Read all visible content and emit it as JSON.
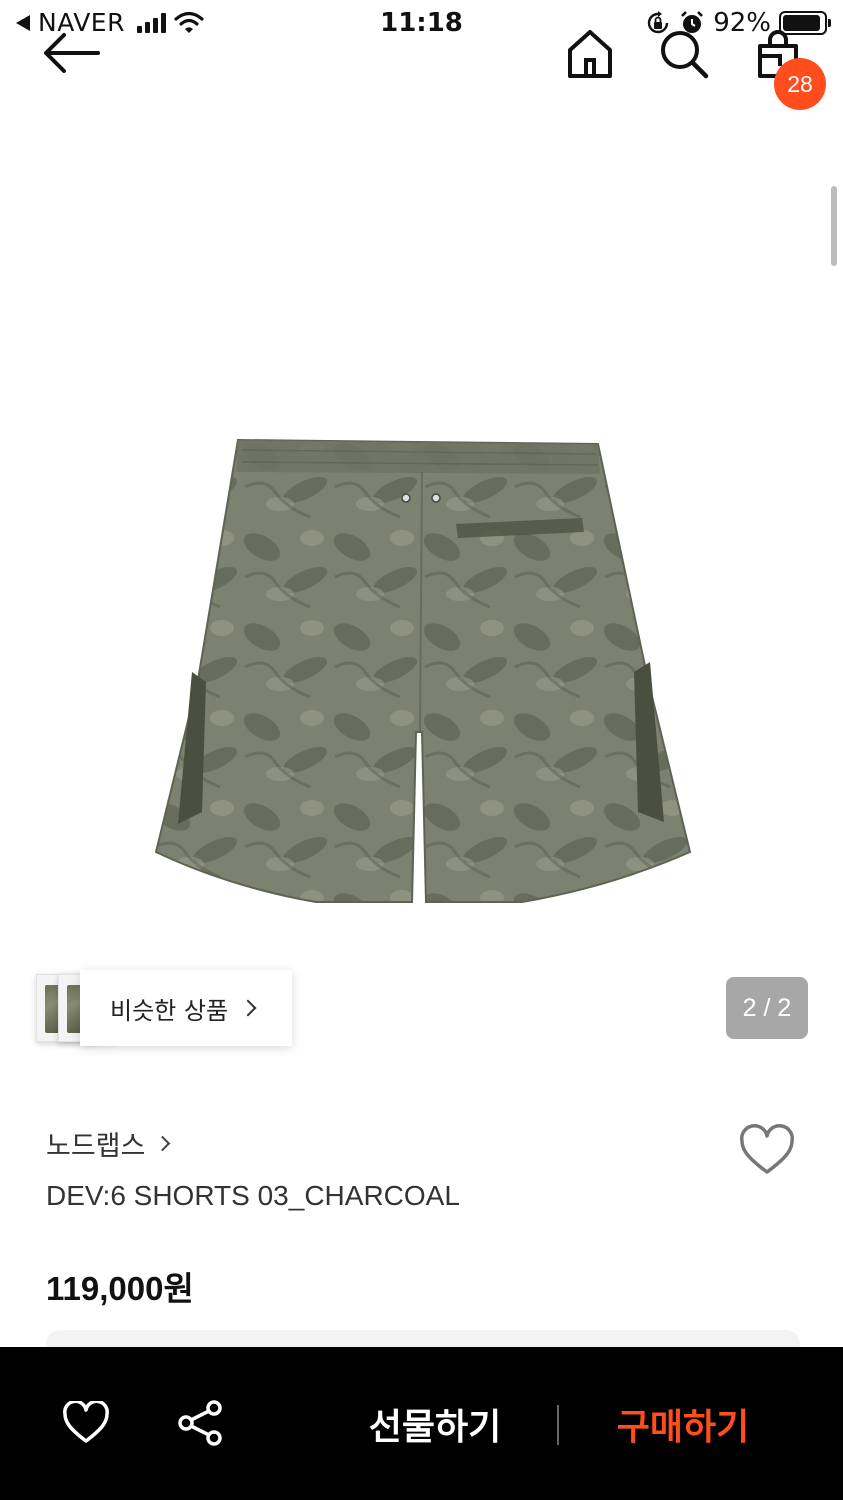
{
  "status_bar": {
    "carrier": "NAVER",
    "time": "11:18",
    "battery_percent": "92%",
    "battery_level": 0.92,
    "icons": [
      "back-to-app-icon",
      "signal-icon",
      "wifi-icon",
      "orientation-lock-icon",
      "alarm-icon",
      "battery-icon"
    ]
  },
  "nav": {
    "icons": [
      "back-arrow-icon",
      "home-icon",
      "search-icon",
      "shopping-bag-icon"
    ],
    "cart_count": "28",
    "accent_color": "#ff4d1d"
  },
  "gallery": {
    "similar_label": "비슷한 상품",
    "page_counter": "2 / 2"
  },
  "product": {
    "brand": "노드랩스",
    "name": "DEV:6 SHORTS 03_CHARCOAL",
    "price": "119,000원"
  },
  "bottom_bar": {
    "gift_label": "선물하기",
    "buy_label": "구매하기",
    "buy_color": "#ff4d1d",
    "icons": [
      "heart-icon",
      "share-icon"
    ]
  }
}
